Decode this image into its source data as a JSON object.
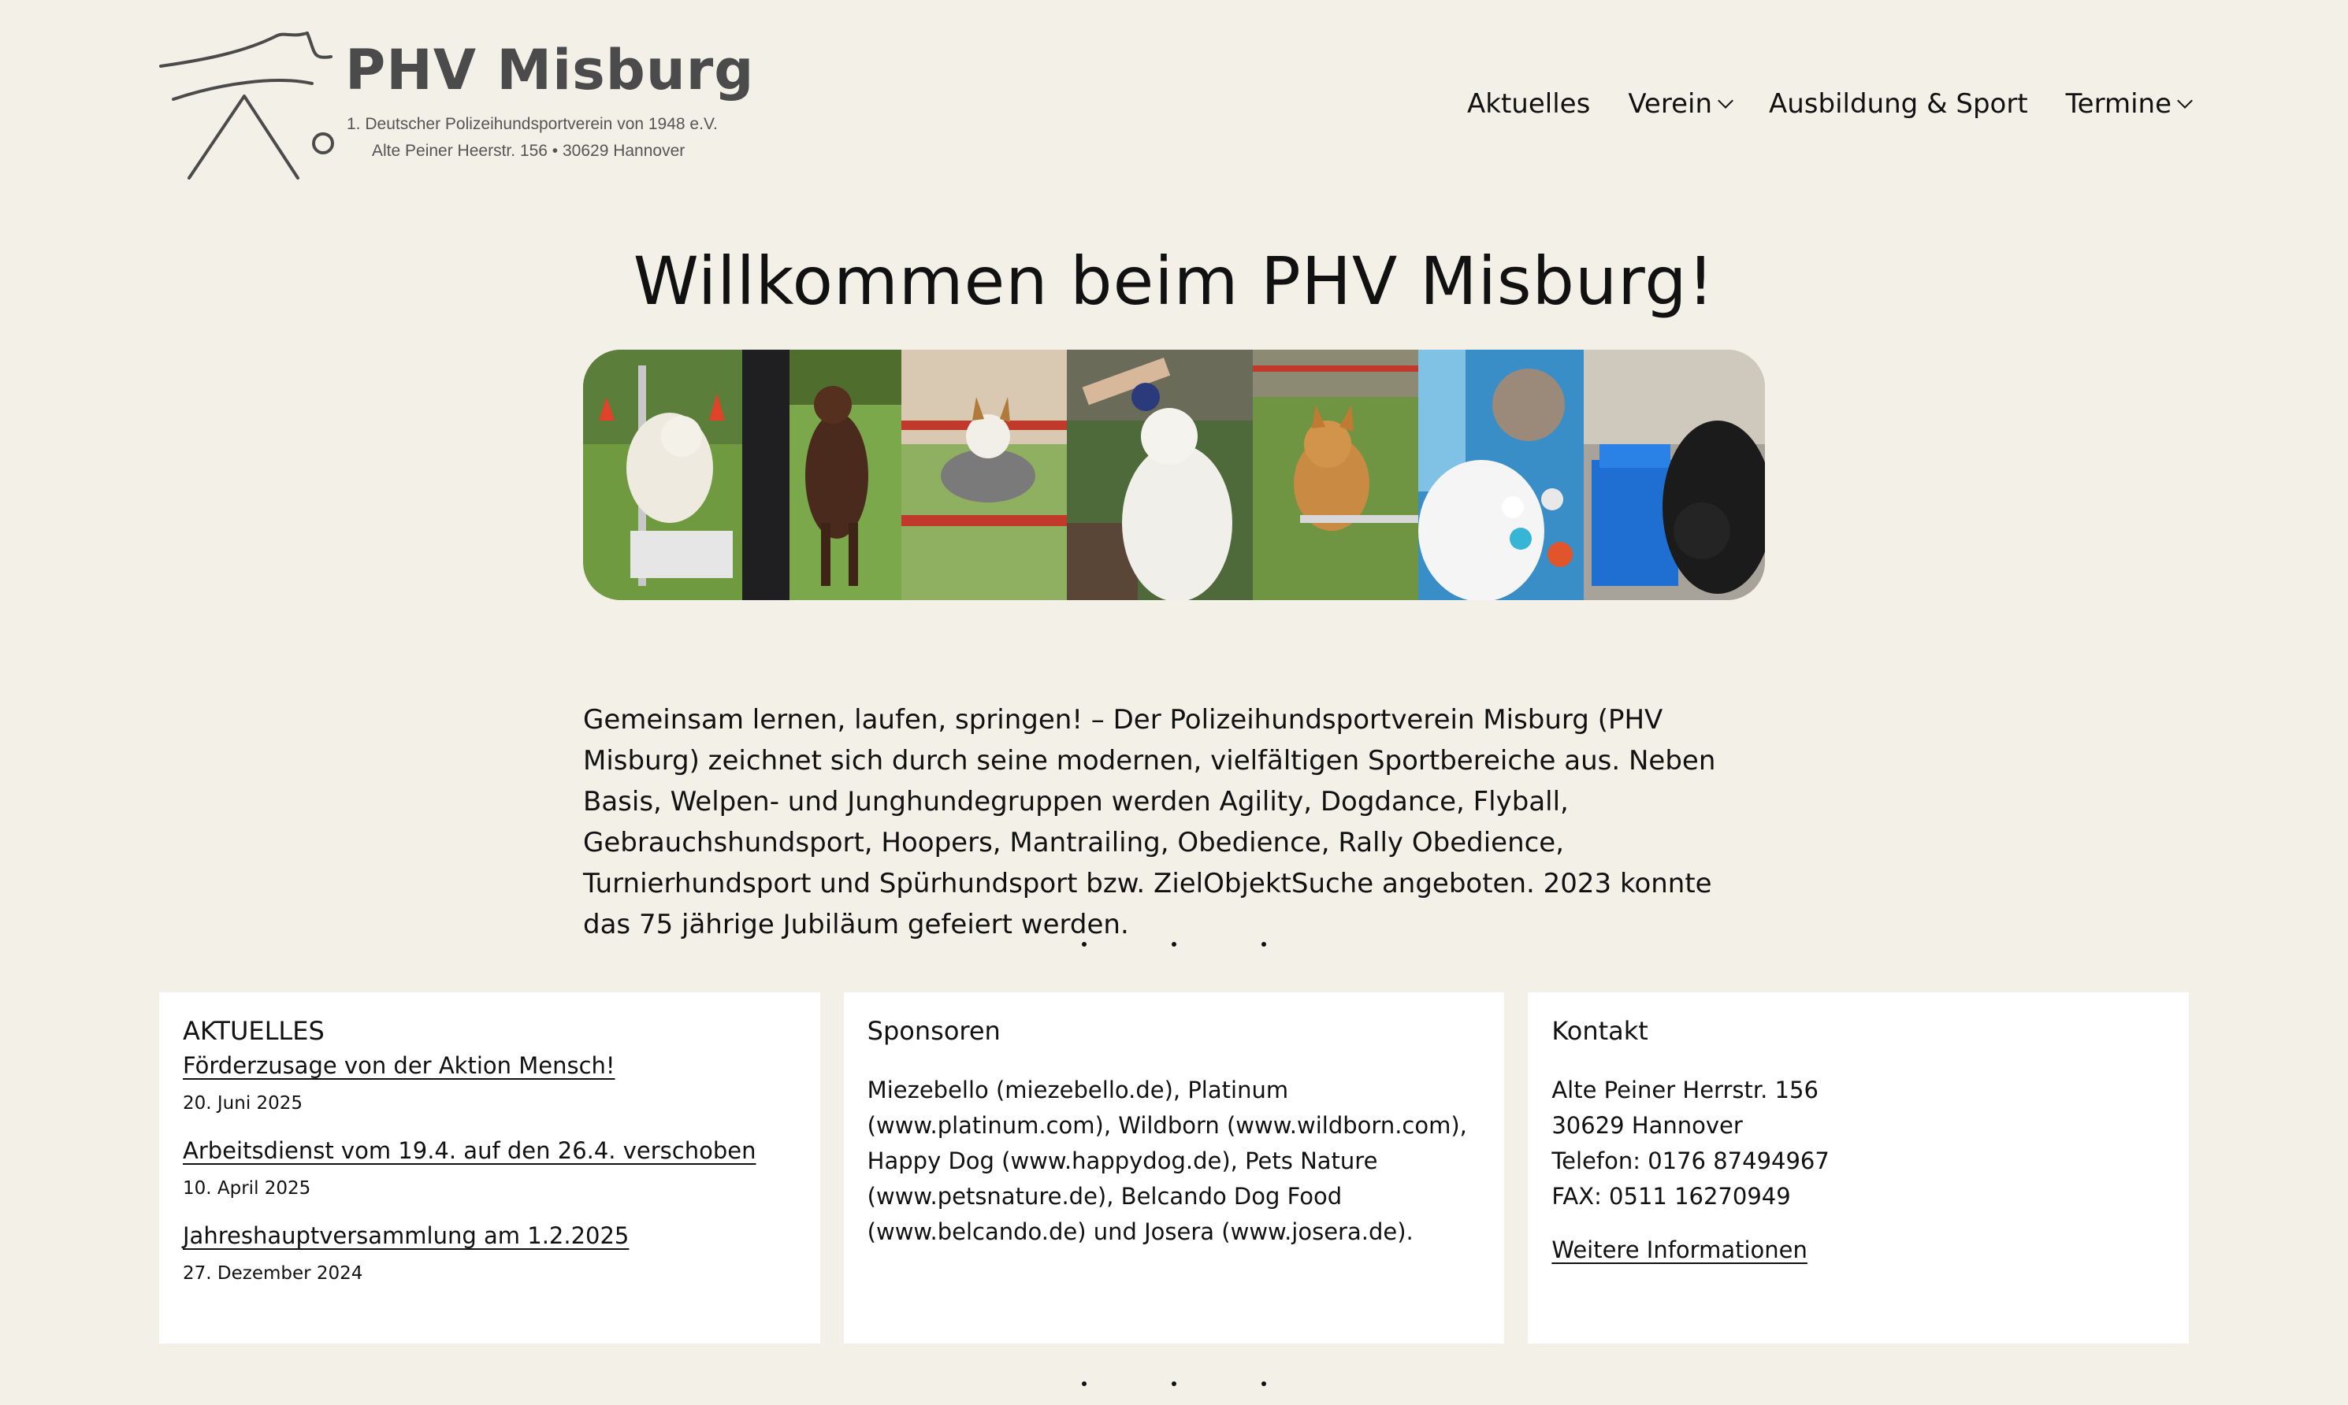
{
  "header": {
    "logo": {
      "name": "PHV Misburg",
      "tagline": "1. Deutscher Polizeihundsportverein von 1948 e.V.",
      "address": "Alte Peiner Heerstr. 156  •  30629 Hannover"
    },
    "nav": [
      {
        "label": "Aktuelles",
        "has_dropdown": false
      },
      {
        "label": "Verein",
        "has_dropdown": true
      },
      {
        "label": "Ausbildung & Sport",
        "has_dropdown": false
      },
      {
        "label": "Termine",
        "has_dropdown": true
      }
    ]
  },
  "hero": {
    "title": "Willkommen beim PHV Misburg!",
    "intro": "Gemeinsam lernen, laufen, springen! – Der Polizeihundsportverein Misburg (PHV Misburg) zeichnet sich durch seine modernen, vielfältigen Sportbereiche aus. Neben Basis, Welpen- und Junghundegruppen werden Agility, Dogdance, Flyball, Gebrauchshundsport, Hoopers, Mantrailing, Obedience, Rally Obedience, Turnierhundsport und Spürhundsport bzw. ZielObjektSuche angeboten. 2023 konnte das 75 jährige Jubiläum gefeiert werden."
  },
  "cards": {
    "news": {
      "heading": "AKTUELLES",
      "items": [
        {
          "title": "Förderzusage von der Aktion Mensch!",
          "date": "20. Juni 2025"
        },
        {
          "title": "Arbeitsdienst vom 19.4. auf den 26.4. verschoben",
          "date": "10. April 2025"
        },
        {
          "title": "Jahreshauptversammlung am 1.2.2025",
          "date": "27. Dezember 2024"
        }
      ]
    },
    "sponsors": {
      "heading": "Sponsoren",
      "text": "Miezebello (miezebello.de), Platinum (www.platinum.com), Wildborn (www.wildborn.com), Happy Dog (www.happydog.de), Pets Nature (www.petsnature.de), Belcando Dog Food (www.belcando.de) und Josera (www.josera.de)."
    },
    "contact": {
      "heading": "Kontakt",
      "street": "Alte Peiner Herrstr. 156",
      "city": "30629 Hannover",
      "phone": "Telefon: 0176 87494967",
      "fax": "FAX: 0511 16270949",
      "more_link": "Weitere Informationen"
    }
  },
  "colors": {
    "page_background": "#f3f0e8",
    "card_background": "#ffffff",
    "text": "#111111",
    "logo_text": "#4b4b4b"
  }
}
